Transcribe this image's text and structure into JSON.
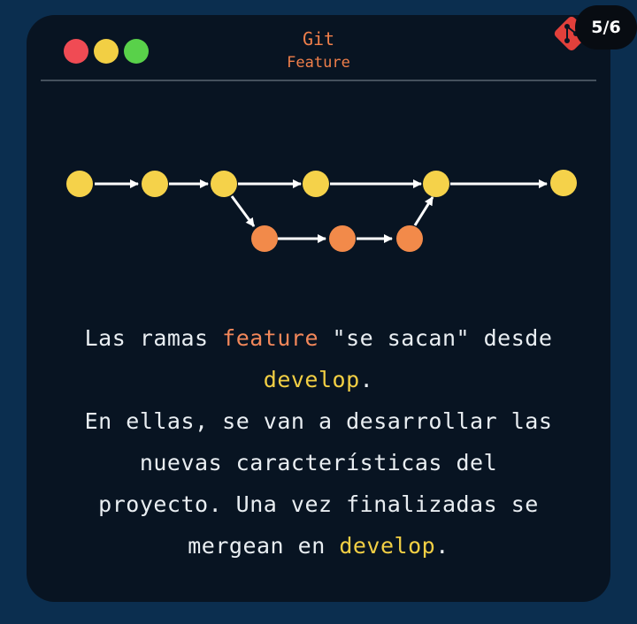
{
  "header": {
    "title": "Git",
    "subtitle": "Feature",
    "page_indicator": "5/6"
  },
  "colors": {
    "background": "#0b2e4f",
    "card": "#081422",
    "develop_commit": "#f5d24a",
    "feature_commit": "#f28a4a",
    "arrow": "#ffffff",
    "highlight_feature": "#f2875a",
    "highlight_develop": "#f2cf44",
    "git_logo": "#e2403b"
  },
  "icons": {
    "window_controls": [
      "close-dot",
      "minimize-dot",
      "maximize-dot"
    ],
    "logo": "git-logo-icon"
  },
  "diagram": {
    "develop_commits": 6,
    "feature_commits": 3,
    "feature_branches_from_commit": 3,
    "feature_merges_into_commit": 5
  },
  "description": {
    "p1_before": "Las ramas ",
    "p1_feature": "feature",
    "p1_middle": " \"se sacan\" desde",
    "p1_develop": "develop",
    "p1_end": ".",
    "p2_line1": "En ellas, se van a desarrollar las",
    "p2_line2": "nuevas características del",
    "p2_line3": "proyecto. Una vez finalizadas se",
    "p2_line4_before": "mergean en ",
    "p2_develop": "develop",
    "p2_end": "."
  }
}
